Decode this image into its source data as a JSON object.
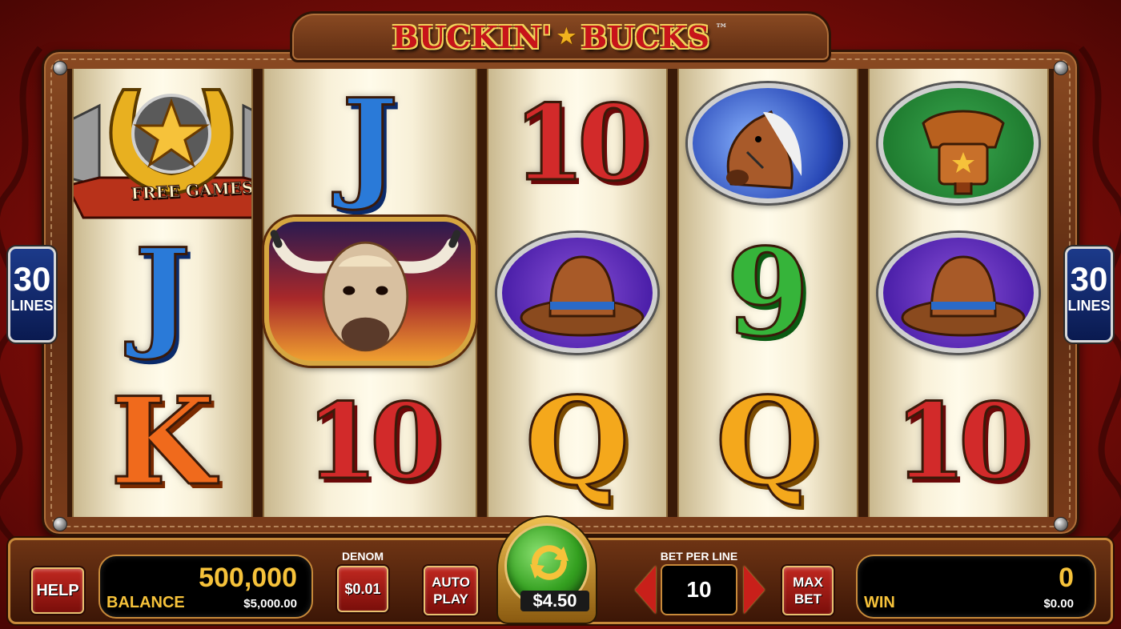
{
  "game": {
    "title_left": "BUCKIN'",
    "title_right": "BUCKS",
    "trademark": "™"
  },
  "side_badges": {
    "left": {
      "number": "30",
      "label": "LINES"
    },
    "right": {
      "number": "30",
      "label": "LINES"
    }
  },
  "reels": [
    [
      {
        "kind": "free_games",
        "label": "FREE GAMES",
        "icon": "horseshoe-star-icon"
      },
      {
        "kind": "text",
        "value": "J"
      },
      {
        "kind": "text",
        "value": "K"
      }
    ],
    [
      {
        "kind": "text",
        "value": "J"
      },
      {
        "kind": "picture",
        "icon": "bull-icon"
      },
      {
        "kind": "text",
        "value": "10"
      }
    ],
    [
      {
        "kind": "text",
        "value": "10"
      },
      {
        "kind": "picture",
        "icon": "cowboy-hat-icon"
      },
      {
        "kind": "text",
        "value": "Q"
      }
    ],
    [
      {
        "kind": "picture",
        "icon": "horse-icon"
      },
      {
        "kind": "text",
        "value": "9"
      },
      {
        "kind": "text",
        "value": "Q"
      }
    ],
    [
      {
        "kind": "picture",
        "icon": "saddle-icon"
      },
      {
        "kind": "picture",
        "icon": "cowboy-hat-icon"
      },
      {
        "kind": "text",
        "value": "10"
      }
    ]
  ],
  "console": {
    "help_label": "HELP",
    "balance_credits": "500,000",
    "balance_label": "BALANCE",
    "balance_dollars": "$5,000.00",
    "denom_label": "DENOM",
    "denom_value": "$0.01",
    "autoplay_line1": "AUTO",
    "autoplay_line2": "PLAY",
    "spin_bet": "$4.50",
    "bet_per_line_label": "BET PER LINE",
    "bet_per_line_value": "10",
    "maxbet_line1": "MAX",
    "maxbet_line2": "BET",
    "win_credits": "0",
    "win_label": "WIN",
    "win_dollars": "$0.00"
  }
}
